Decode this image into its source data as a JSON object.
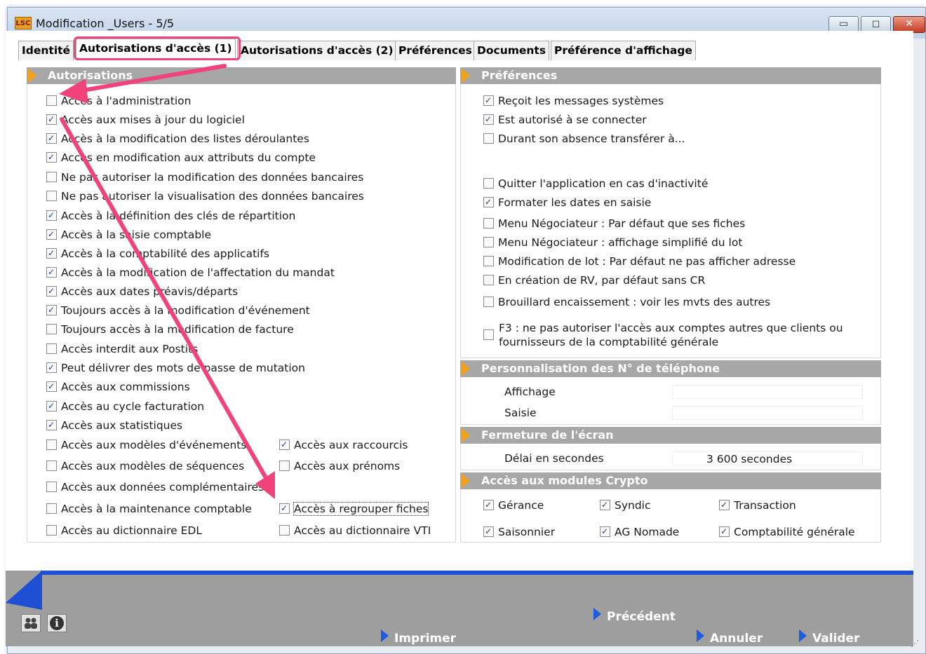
{
  "window": {
    "logo": "LSC",
    "title": "Modification _Users - 5/5",
    "minimize": "▭",
    "maximize": "◻",
    "close": "✕"
  },
  "tabs": [
    {
      "label": "Identité"
    },
    {
      "label": "Autorisations d'accès (1)",
      "active": true
    },
    {
      "label": "Autorisations d'accès (2)"
    },
    {
      "label": "Préférences"
    },
    {
      "label": "Documents"
    },
    {
      "label": "Préférence d'affichage"
    }
  ],
  "autorisations": {
    "header": "Autorisations",
    "items": [
      {
        "label": "Accès à l'administration",
        "checked": false
      },
      {
        "label": "Accès aux mises à jour du logiciel",
        "checked": true
      },
      {
        "label": "Accès à la modification des listes déroulantes",
        "checked": true
      },
      {
        "label": "Accès en modification aux attributs du compte",
        "checked": true
      },
      {
        "label": "Ne pas autoriser la modification des données bancaires",
        "checked": false
      },
      {
        "label": "Ne pas autoriser la visualisation des données bancaires",
        "checked": false
      },
      {
        "label": "Accès à la définition des clés de répartition",
        "checked": true
      },
      {
        "label": "Accès à la saisie comptable",
        "checked": true
      },
      {
        "label": "Accès à la comptabilité des applicatifs",
        "checked": true
      },
      {
        "label": "Accès à la modification de l'affectation du mandat",
        "checked": true
      },
      {
        "label": "Accès aux dates préavis/départs",
        "checked": true
      },
      {
        "label": "Toujours accès à la modification d'événement",
        "checked": true
      },
      {
        "label": "Toujours accès à la modification de facture",
        "checked": false
      },
      {
        "label": "Accès interdit aux Postits",
        "checked": false
      },
      {
        "label": "Peut délivrer des mots de passe de mutation",
        "checked": true
      },
      {
        "label": "Accès aux commissions",
        "checked": true
      },
      {
        "label": "Accès au cycle facturation",
        "checked": true
      },
      {
        "label": "Accès aux statistiques",
        "checked": true
      },
      {
        "label": "Accès aux modèles d'événements",
        "checked": false
      },
      {
        "label": "Accès aux modèles de séquences",
        "checked": false
      },
      {
        "label": "Accès aux données complémentaires",
        "checked": false
      },
      {
        "label": "Accès à la maintenance comptable",
        "checked": false
      },
      {
        "label": "Accès au dictionnaire EDL",
        "checked": false
      }
    ],
    "right_items": [
      {
        "label": "Accès aux raccourcis",
        "checked": true
      },
      {
        "label": "Accès aux prénoms",
        "checked": false
      },
      {
        "label": "Accès à regrouper fiches",
        "checked": true
      },
      {
        "label": "Accès au dictionnaire VTI",
        "checked": false
      }
    ]
  },
  "preferences": {
    "header": "Préférences",
    "items": [
      {
        "label": "Reçoit les messages systèmes",
        "checked": true
      },
      {
        "label": "Est autorisé à se connecter",
        "checked": true
      },
      {
        "label": "Durant son absence transférer à...",
        "checked": false
      },
      {
        "label": "Quitter l'application en cas d'inactivité",
        "checked": false
      },
      {
        "label": "Formater les dates en saisie",
        "checked": true
      },
      {
        "label": "Menu Négociateur : Par défaut que ses fiches",
        "checked": false
      },
      {
        "label": "Menu Négociateur : affichage simplifié du lot",
        "checked": false
      },
      {
        "label": "Modification de lot : Par défaut ne pas afficher adresse",
        "checked": false
      },
      {
        "label": "En création de RV, par défaut sans CR",
        "checked": false
      },
      {
        "label": "Brouillard encaissement : voir les mvts des autres",
        "checked": false
      }
    ],
    "f3": {
      "line1": "F3 : ne pas autoriser l'accès aux comptes autres que clients ou",
      "line2": "fournisseurs de la comptabilité générale",
      "checked": false
    }
  },
  "telephone": {
    "header": "Personnalisation des N° de téléphone",
    "affichage_label": "Affichage",
    "affichage_value": "",
    "saisie_label": "Saisie",
    "saisie_value": ""
  },
  "fermeture": {
    "header": "Fermeture de l'écran",
    "delai_label": "Délai en secondes",
    "delai_value": "3 600 secondes"
  },
  "crypto": {
    "header": "Accès aux modules Crypto",
    "items": [
      {
        "label": "Gérance",
        "checked": true
      },
      {
        "label": "Syndic",
        "checked": true
      },
      {
        "label": "Transaction",
        "checked": true
      },
      {
        "label": "Saisonnier",
        "checked": true
      },
      {
        "label": "AG Nomade",
        "checked": true
      },
      {
        "label": "Comptabilité générale",
        "checked": true
      }
    ]
  },
  "footer": {
    "precedent": "Précédent",
    "imprimer": "Imprimer",
    "annuler": "Annuler",
    "valider": "Valider",
    "users_icon": "users-icon",
    "info_icon": "info-icon",
    "info_glyph": "i"
  },
  "colors": {
    "accent_arrow": "#f0437a",
    "section_header": "#a7a7a7",
    "section_marker": "#f4a11a",
    "footer_button_marker": "#1b5ce0"
  }
}
